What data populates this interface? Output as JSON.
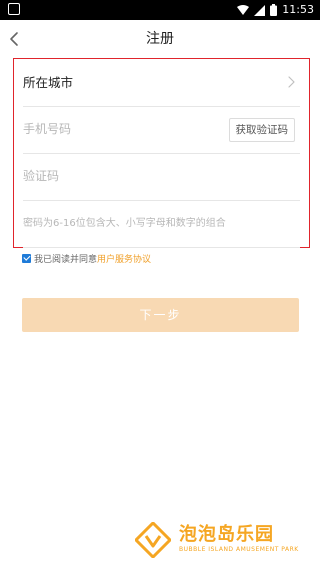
{
  "status_bar": {
    "time": "11:53"
  },
  "nav": {
    "title": "注册"
  },
  "form": {
    "city_label": "所在城市",
    "phone_placeholder": "手机号码",
    "get_code_label": "获取验证码",
    "code_placeholder": "验证码",
    "password_hint": "密码为6-16位包含大、小写字母和数字的组合"
  },
  "agreement": {
    "checked": true,
    "text": "我已阅读并同意",
    "link": "用户服务协议"
  },
  "next_button": {
    "label": "下一步"
  },
  "watermark": {
    "title": "泡泡岛乐园",
    "subtitle": "BUBBLE ISLAND AMUSEMENT PARK"
  },
  "colors": {
    "highlight_border": "#e0242c",
    "link": "#f0a02a",
    "next_button_bg": "#f8d9b3",
    "checkbox": "#1f7bd8"
  }
}
